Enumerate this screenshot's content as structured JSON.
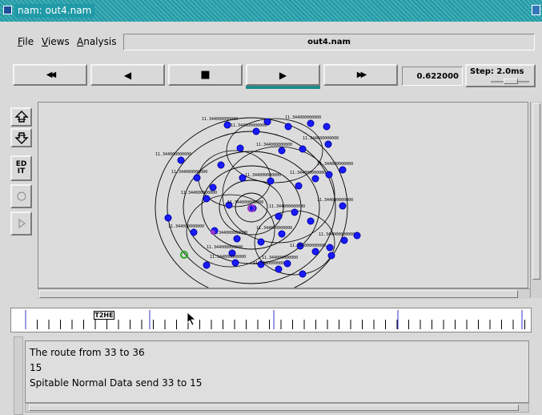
{
  "window": {
    "title": "nam: out4.nam"
  },
  "menubar": {
    "items": [
      {
        "label": "File",
        "underline": "F",
        "rest": "ile"
      },
      {
        "label": "Views",
        "underline": "V",
        "rest": "iews"
      },
      {
        "label": "Analysis",
        "underline": "A",
        "rest": "nalysis"
      }
    ],
    "filename": "out4.nam"
  },
  "controls": {
    "rewind": "◀◀",
    "back": "◀",
    "stop": "■",
    "play": "▶",
    "fast_forward": "▶▶",
    "time": "0.622000",
    "step_label": "Step: 2.0ms"
  },
  "tools": {
    "zoom_in": "⇪",
    "zoom_out": "⇩",
    "edit": "ED\nIT"
  },
  "canvas": {
    "node_label": "11.344000000000"
  },
  "timeline": {
    "marker_label": "T2HE"
  },
  "log": {
    "lines": [
      "The route from 33 to 36",
      "15",
      "Spitable Normal Data send 33 to 15"
    ]
  },
  "colors": {
    "titlebar": "#1f9aa6",
    "node": "#1a1aff",
    "node_source": "#9933cc",
    "node_dest": "#22aa22",
    "play_accent": "#1f8a8a"
  }
}
